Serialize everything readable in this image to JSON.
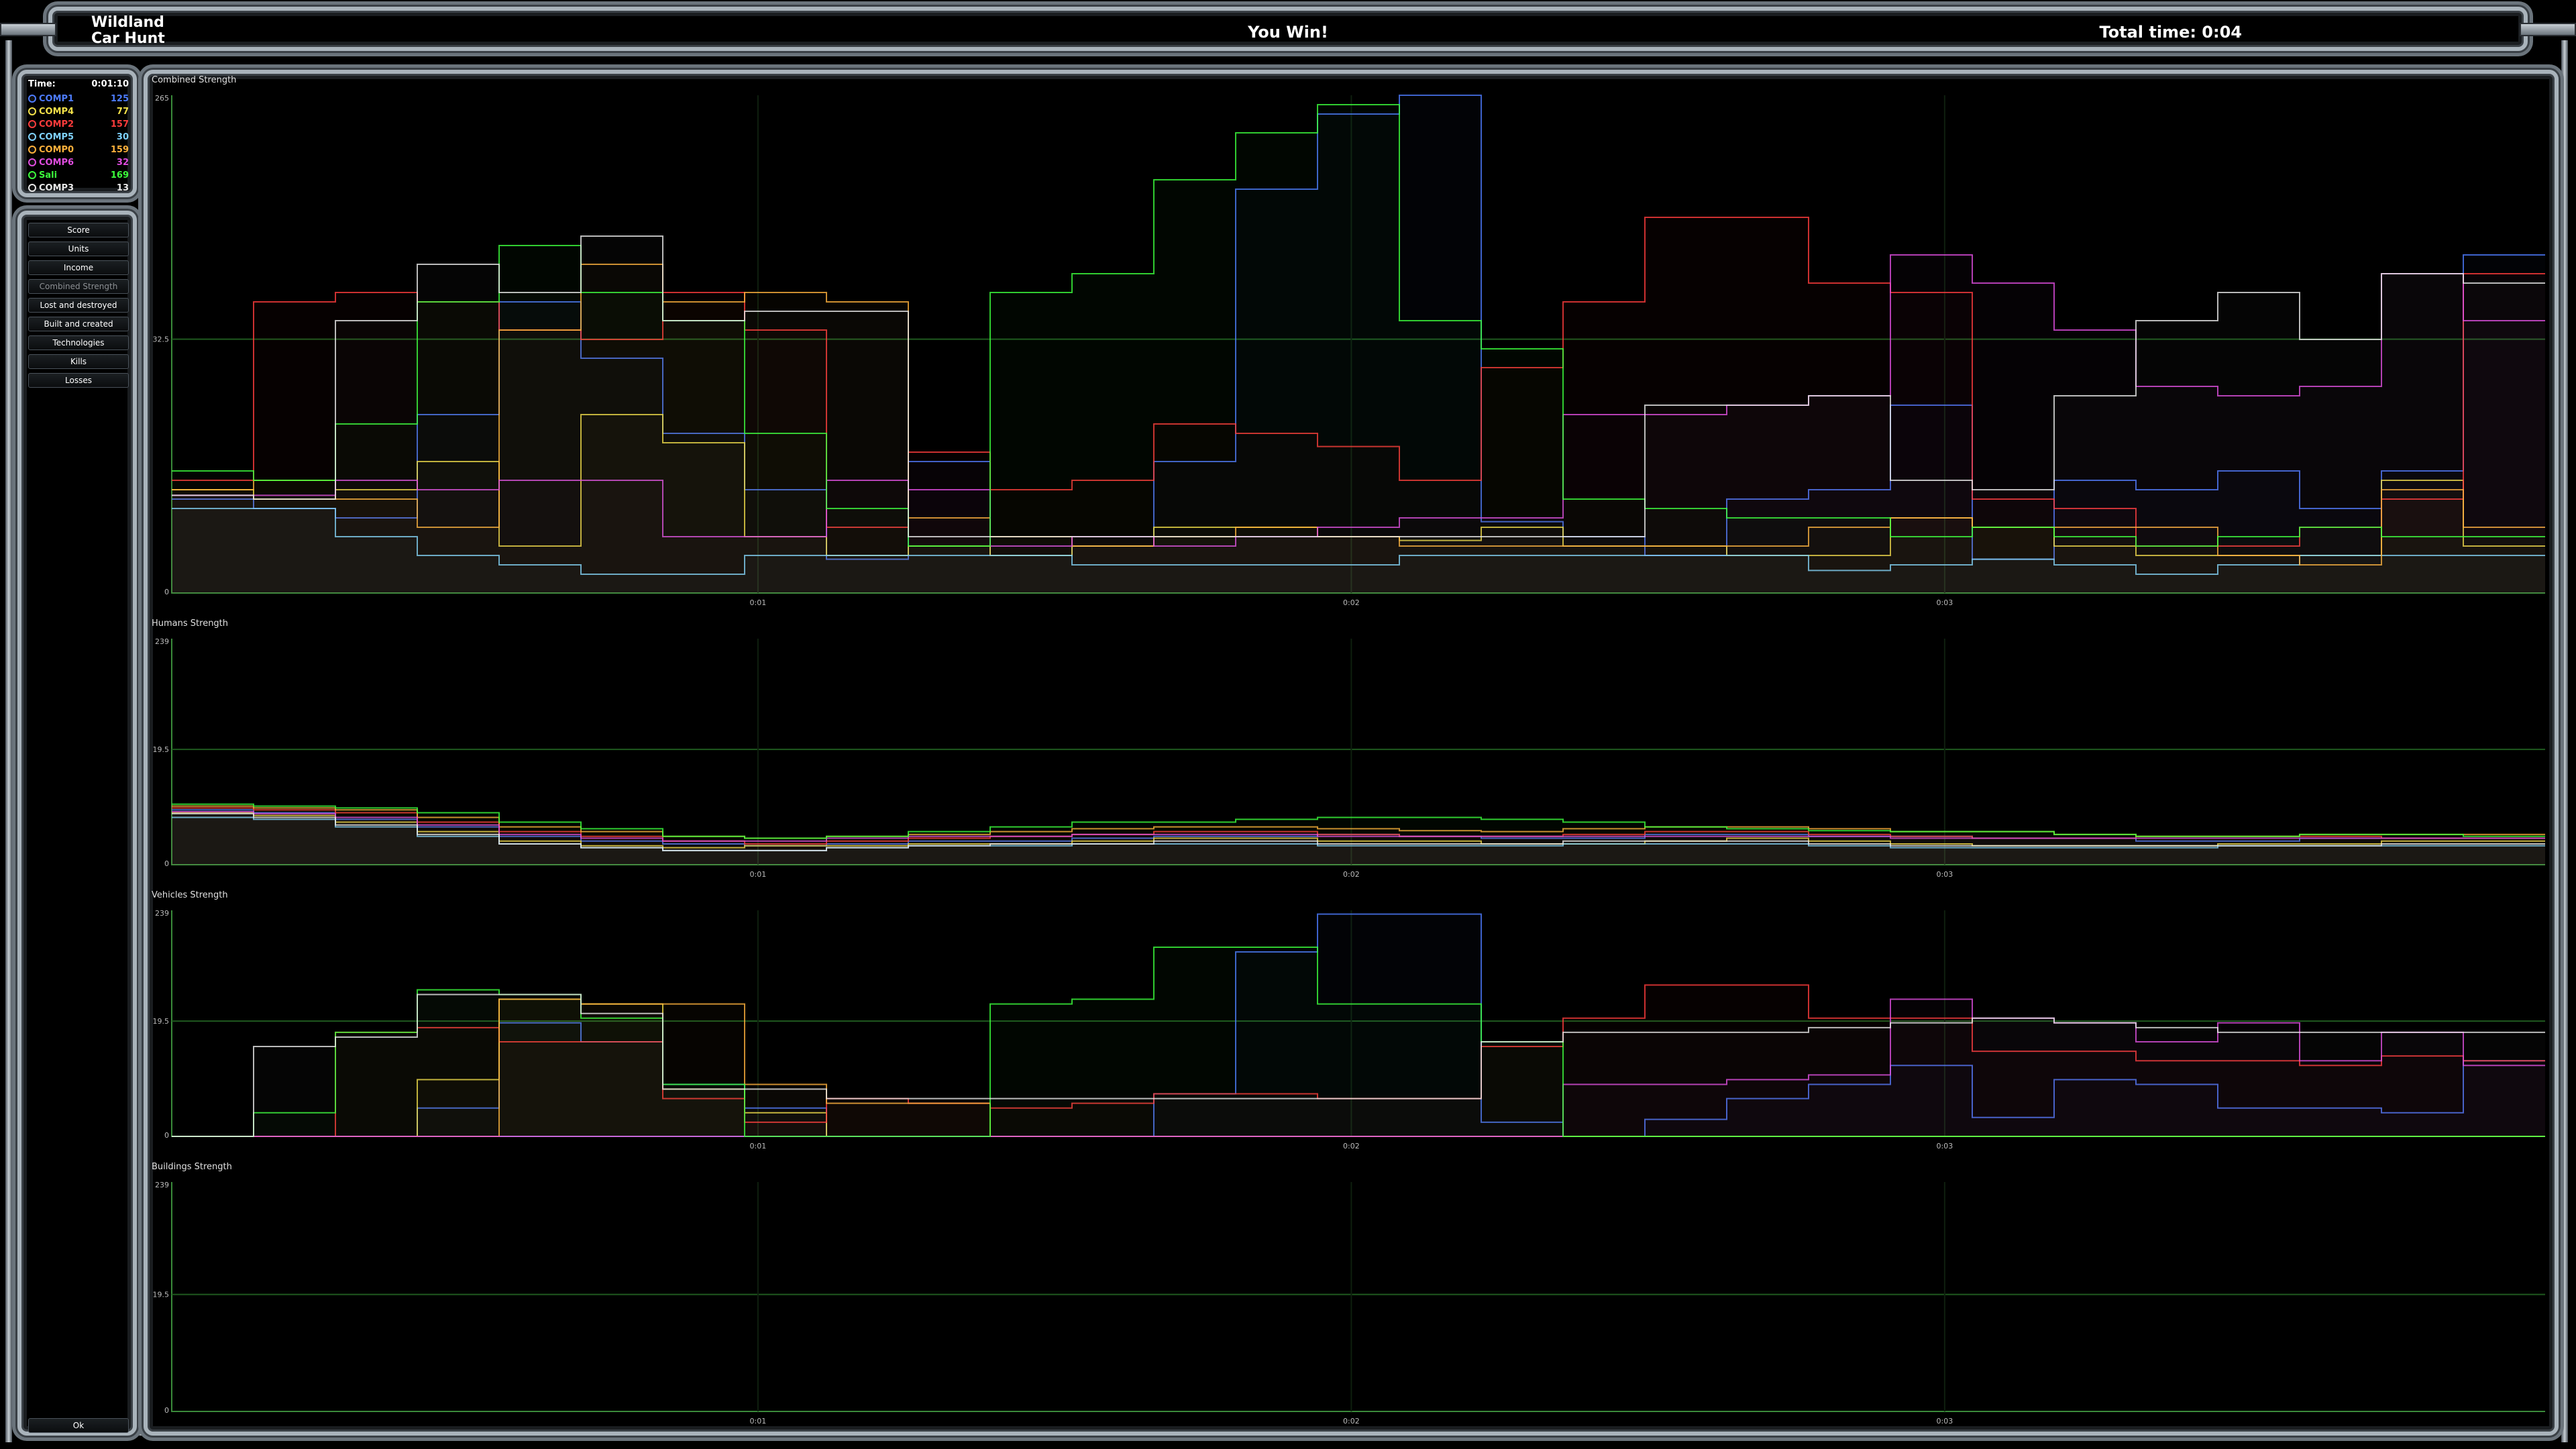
{
  "header": {
    "map_name_line1": "Wildland",
    "map_name_line2": "Car Hunt",
    "result": "You Win!",
    "total_time": "Total time: 0:04"
  },
  "players_panel": {
    "time_label": "Time:",
    "time_value": "0:01:10",
    "players": [
      {
        "name": "COMP1",
        "value": "125",
        "color": "#4d7cff"
      },
      {
        "name": "COMP4",
        "value": "77",
        "color": "#f4e24a"
      },
      {
        "name": "COMP2",
        "value": "157",
        "color": "#ff3c3c"
      },
      {
        "name": "COMP5",
        "value": "30",
        "color": "#7fd3ff"
      },
      {
        "name": "COMP0",
        "value": "159",
        "color": "#ffb23c"
      },
      {
        "name": "COMP6",
        "value": "32",
        "color": "#e04de0"
      },
      {
        "name": "Sali",
        "value": "169",
        "color": "#3cff3c"
      },
      {
        "name": "COMP3",
        "value": "13",
        "color": "#e8e8e8"
      }
    ]
  },
  "menu": {
    "items": [
      "Score",
      "Units",
      "Income",
      "Combined Strength",
      "Lost and destroyed",
      "Built and created",
      "Technologies",
      "Kills",
      "Losses"
    ],
    "active": "Combined Strength",
    "ok_label": "Ok"
  },
  "chart_data": [
    {
      "type": "line",
      "title": "Combined Strength",
      "y_ticks": [
        "265",
        "32.5",
        "0"
      ],
      "x_ticks": [
        "0:01",
        "0:02",
        "0:03"
      ],
      "ylim": [
        0,
        265
      ],
      "x": [
        0,
        1,
        2,
        3,
        4,
        5,
        6,
        7,
        8,
        9,
        10,
        11,
        12,
        13,
        14,
        15,
        16,
        17,
        18,
        19,
        20,
        21,
        22,
        23,
        24,
        25,
        26,
        27,
        28
      ],
      "series": [
        {
          "color": "#4d7cff",
          "values": [
            50,
            45,
            40,
            95,
            155,
            125,
            85,
            55,
            18,
            70,
            20,
            25,
            70,
            215,
            255,
            265,
            38,
            30,
            20,
            50,
            55,
            100,
            18,
            60,
            55,
            65,
            45,
            65,
            180
          ]
        },
        {
          "color": "#f4e24a",
          "values": [
            55,
            50,
            55,
            70,
            25,
            95,
            80,
            30,
            20,
            25,
            20,
            25,
            35,
            35,
            30,
            28,
            35,
            25,
            25,
            20,
            20,
            40,
            35,
            25,
            20,
            20,
            20,
            60,
            25
          ]
        },
        {
          "color": "#ff3c3c",
          "values": [
            60,
            155,
            160,
            155,
            140,
            135,
            160,
            140,
            35,
            75,
            55,
            60,
            90,
            85,
            78,
            60,
            120,
            155,
            200,
            200,
            165,
            160,
            50,
            45,
            25,
            25,
            35,
            50,
            170
          ]
        },
        {
          "color": "#7fd3ff",
          "values": [
            45,
            45,
            30,
            20,
            15,
            10,
            10,
            20,
            20,
            20,
            20,
            15,
            15,
            15,
            15,
            20,
            20,
            20,
            20,
            20,
            12,
            15,
            18,
            15,
            10,
            15,
            20,
            20,
            20
          ]
        },
        {
          "color": "#ffb23c",
          "values": [
            55,
            60,
            50,
            35,
            140,
            175,
            155,
            160,
            155,
            40,
            30,
            25,
            30,
            35,
            30,
            25,
            25,
            25,
            25,
            25,
            35,
            40,
            35,
            35,
            35,
            20,
            15,
            55,
            35
          ]
        },
        {
          "color": "#e04de0",
          "values": [
            52,
            52,
            60,
            55,
            60,
            60,
            30,
            30,
            60,
            55,
            25,
            30,
            25,
            30,
            35,
            40,
            40,
            95,
            95,
            100,
            105,
            180,
            165,
            140,
            110,
            105,
            110,
            170,
            145
          ]
        },
        {
          "color": "#3cff3c",
          "values": [
            65,
            60,
            90,
            155,
            185,
            160,
            145,
            85,
            45,
            25,
            160,
            170,
            220,
            245,
            260,
            145,
            130,
            50,
            45,
            40,
            40,
            30,
            35,
            30,
            25,
            30,
            35,
            30,
            30
          ]
        },
        {
          "color": "#e8e8e8",
          "values": [
            52,
            50,
            145,
            175,
            160,
            190,
            145,
            150,
            150,
            30,
            30,
            30,
            30,
            30,
            30,
            30,
            30,
            30,
            100,
            100,
            105,
            60,
            55,
            105,
            145,
            160,
            135,
            170,
            165
          ]
        }
      ]
    },
    {
      "type": "line",
      "title": "Humans Strength",
      "y_ticks": [
        "239",
        "19.5",
        "0"
      ],
      "x_ticks": [
        "0:01",
        "0:02",
        "0:03"
      ],
      "ylim": [
        0,
        239
      ],
      "x": [
        0,
        1,
        2,
        3,
        4,
        5,
        6,
        7,
        8,
        9,
        10,
        11,
        12,
        13,
        14,
        15,
        16,
        17,
        18,
        19,
        20,
        21,
        22,
        23,
        24,
        25,
        26,
        27,
        28
      ],
      "series": [
        {
          "color": "#4d7cff",
          "values": [
            58,
            55,
            48,
            40,
            30,
            25,
            22,
            20,
            22,
            25,
            25,
            28,
            30,
            30,
            32,
            30,
            28,
            28,
            32,
            32,
            30,
            30,
            28,
            28,
            25,
            25,
            28,
            28,
            28
          ]
        },
        {
          "color": "#f4e24a",
          "values": [
            55,
            52,
            45,
            35,
            25,
            20,
            18,
            20,
            20,
            22,
            22,
            25,
            28,
            28,
            25,
            25,
            22,
            22,
            25,
            28,
            25,
            22,
            20,
            20,
            20,
            22,
            22,
            25,
            25
          ]
        },
        {
          "color": "#ff3c3c",
          "values": [
            60,
            58,
            55,
            45,
            35,
            30,
            25,
            22,
            25,
            28,
            30,
            32,
            35,
            35,
            32,
            30,
            30,
            32,
            35,
            35,
            32,
            30,
            28,
            28,
            30,
            30,
            30,
            28,
            28
          ]
        },
        {
          "color": "#7fd3ff",
          "values": [
            50,
            48,
            40,
            30,
            22,
            18,
            15,
            15,
            18,
            20,
            20,
            22,
            22,
            22,
            20,
            20,
            20,
            22,
            22,
            22,
            20,
            18,
            18,
            18,
            18,
            20,
            20,
            20,
            20
          ]
        },
        {
          "color": "#ffb23c",
          "values": [
            62,
            60,
            58,
            50,
            40,
            35,
            30,
            28,
            30,
            32,
            35,
            38,
            40,
            40,
            38,
            36,
            35,
            38,
            40,
            40,
            38,
            35,
            35,
            32,
            30,
            30,
            32,
            32,
            32
          ]
        },
        {
          "color": "#e04de0",
          "values": [
            56,
            54,
            50,
            42,
            32,
            28,
            25,
            25,
            28,
            30,
            30,
            32,
            32,
            32,
            30,
            30,
            30,
            30,
            30,
            30,
            30,
            28,
            28,
            28,
            28,
            28,
            28,
            28,
            28
          ]
        },
        {
          "color": "#3cff3c",
          "values": [
            64,
            62,
            60,
            55,
            45,
            38,
            30,
            28,
            30,
            35,
            40,
            45,
            45,
            48,
            50,
            50,
            48,
            45,
            40,
            38,
            36,
            35,
            35,
            32,
            30,
            30,
            32,
            32,
            30
          ]
        },
        {
          "color": "#e8e8e8",
          "values": [
            54,
            50,
            42,
            32,
            22,
            18,
            15,
            15,
            18,
            20,
            22,
            22,
            25,
            25,
            22,
            22,
            22,
            25,
            25,
            25,
            22,
            20,
            20,
            20,
            20,
            20,
            20,
            22,
            22
          ]
        }
      ]
    },
    {
      "type": "line",
      "title": "Vehicles Strength",
      "y_ticks": [
        "239",
        "19.5",
        "0"
      ],
      "x_ticks": [
        "0:01",
        "0:02",
        "0:03"
      ],
      "ylim": [
        0,
        239
      ],
      "x": [
        0,
        1,
        2,
        3,
        4,
        5,
        6,
        7,
        8,
        9,
        10,
        11,
        12,
        13,
        14,
        15,
        16,
        17,
        18,
        19,
        20,
        21,
        22,
        23,
        24,
        25,
        26,
        27,
        28
      ],
      "series": [
        {
          "color": "#4d7cff",
          "values": [
            0,
            0,
            0,
            30,
            120,
            100,
            55,
            30,
            0,
            0,
            0,
            0,
            45,
            195,
            235,
            235,
            15,
            0,
            18,
            40,
            55,
            75,
            20,
            60,
            55,
            30,
            30,
            25,
            80
          ]
        },
        {
          "color": "#f4e24a",
          "values": [
            0,
            0,
            0,
            60,
            145,
            140,
            50,
            25,
            0,
            0,
            0,
            0,
            0,
            0,
            0,
            0,
            0,
            0,
            0,
            0,
            0,
            0,
            0,
            0,
            0,
            0,
            0,
            0,
            0
          ]
        },
        {
          "color": "#ff3c3c",
          "values": [
            0,
            0,
            110,
            115,
            100,
            100,
            40,
            15,
            40,
            35,
            30,
            35,
            45,
            45,
            40,
            40,
            95,
            125,
            160,
            160,
            125,
            125,
            90,
            90,
            80,
            80,
            75,
            85,
            80
          ]
        },
        {
          "color": "#7fd3ff",
          "values": [
            0,
            0,
            0,
            0,
            0,
            0,
            0,
            0,
            0,
            0,
            0,
            0,
            0,
            0,
            0,
            0,
            0,
            0,
            0,
            0,
            0,
            0,
            0,
            0,
            0,
            0,
            0,
            0,
            0
          ]
        },
        {
          "color": "#ffb23c",
          "values": [
            0,
            0,
            0,
            0,
            145,
            140,
            140,
            55,
            35,
            35,
            0,
            0,
            0,
            0,
            0,
            0,
            0,
            0,
            0,
            0,
            0,
            0,
            0,
            0,
            0,
            0,
            0,
            0,
            0
          ]
        },
        {
          "color": "#e04de0",
          "values": [
            0,
            0,
            0,
            0,
            0,
            0,
            0,
            0,
            0,
            0,
            0,
            0,
            0,
            0,
            0,
            0,
            0,
            55,
            55,
            60,
            65,
            145,
            125,
            120,
            100,
            120,
            80,
            110,
            75
          ]
        },
        {
          "color": "#3cff3c",
          "values": [
            0,
            25,
            110,
            155,
            150,
            125,
            55,
            0,
            0,
            0,
            140,
            145,
            200,
            200,
            140,
            140,
            100,
            0,
            0,
            0,
            0,
            0,
            0,
            0,
            0,
            0,
            0,
            0,
            0
          ]
        },
        {
          "color": "#e8e8e8",
          "values": [
            0,
            95,
            105,
            150,
            150,
            130,
            50,
            50,
            40,
            40,
            40,
            40,
            40,
            40,
            40,
            40,
            100,
            110,
            110,
            110,
            115,
            120,
            125,
            120,
            115,
            110,
            110,
            110,
            110
          ]
        }
      ]
    },
    {
      "type": "line",
      "title": "Buildings Strength",
      "y_ticks": [
        "239",
        "19.5",
        "0"
      ],
      "x_ticks": [
        "0:01",
        "0:02",
        "0:03"
      ],
      "ylim": [
        0,
        239
      ],
      "x": [
        0,
        1,
        2,
        3,
        4,
        5,
        6,
        7,
        8,
        9,
        10,
        11,
        12,
        13,
        14,
        15,
        16,
        17,
        18,
        19,
        20,
        21,
        22,
        23,
        24,
        25,
        26,
        27,
        28
      ],
      "series": []
    }
  ]
}
